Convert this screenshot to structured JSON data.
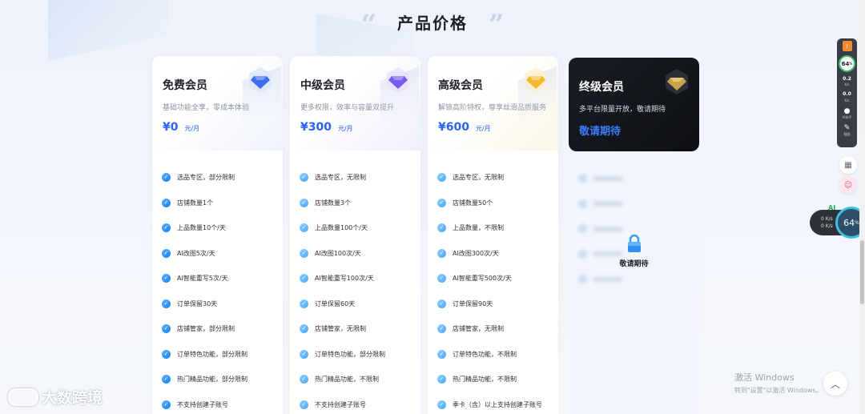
{
  "header": {
    "title": "产品价格",
    "quote_left": "“",
    "quote_right": "”"
  },
  "plans": [
    {
      "name": "免费会员",
      "desc": "基础功能全享，零成本体验",
      "price": "¥0",
      "unit": "元/月",
      "gem_color": "#3d6ef0",
      "features": [
        "选品专区，部分限制",
        "店铺数量1个",
        "上品数量10个/天",
        "AI改图5次/天",
        "AI智能重写5次/天",
        "订单保留30天",
        "店铺管家，部分限制",
        "订单特色功能，部分限制",
        "热门精品功能，部分限制",
        "不支持创建子账号"
      ]
    },
    {
      "name": "中级会员",
      "desc": "更多权限，效率与容量双提升",
      "price": "¥300",
      "unit": "元/月",
      "gem_color": "#7a5cf2",
      "features": [
        "选品专区，无限制",
        "店铺数量3个",
        "上品数量100个/天",
        "AI改图100次/天",
        "AI智能重写100次/天",
        "订单保留60天",
        "店铺管家，无限制",
        "订单特色功能，部分限制",
        "热门精品功能，不限制",
        "不支持创建子账号"
      ]
    },
    {
      "name": "高级会员",
      "desc": "解锁高阶特权，尊享丝滑品质服务",
      "price": "¥600",
      "unit": "元/月",
      "gem_color": "#f2b82e",
      "features": [
        "选品专区，无限制",
        "店铺数量50个",
        "上品数量，不限制",
        "AI改图300次/天",
        "AI智能重写500次/天",
        "订单保留90天",
        "店铺管家，无限制",
        "订单特色功能，不限制",
        "热门精品功能，不限制",
        "季卡（含）以上支持创建子账号"
      ]
    },
    {
      "name": "终级会员",
      "desc": "多平台限量开放，敬请期待",
      "coming": "敬请期待",
      "lock_label": "敬请期待",
      "gem_color": "#c9a24a"
    }
  ],
  "side_widget": {
    "badge": "!",
    "percent": "64",
    "percent_suffix": "%",
    "stat1": "0.2",
    "stat1_unit": "K/s",
    "stat2": "0.0",
    "stat2_unit": "K/s",
    "ai_label": "AI助手",
    "edit_label": "截图"
  },
  "net_widget": {
    "ai": "AI",
    "up": "0 K/s",
    "down": "0 K/s",
    "percent": "64",
    "percent_suffix": "%"
  },
  "brand": {
    "name": "大数跨境"
  },
  "watermark": {
    "line1": "激活 Windows",
    "line2": "转到\"设置\"以激活 Windows。"
  },
  "colors": {
    "accent": "#2a63f6",
    "check": "#1c7ef0",
    "ultimate_bg": "#111318"
  }
}
